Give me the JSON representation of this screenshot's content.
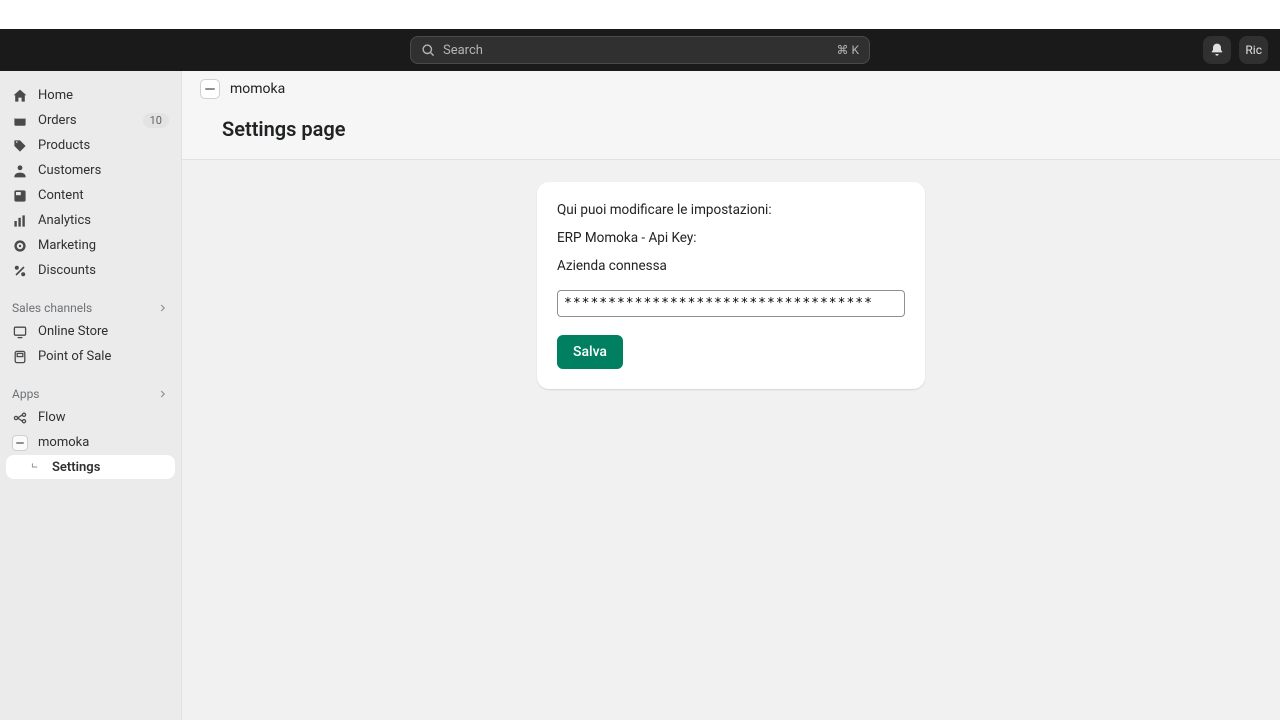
{
  "topbar": {
    "search_placeholder": "Search",
    "search_shortcut": "⌘ K",
    "user_short": "Ric"
  },
  "sidebar": {
    "items": [
      {
        "label": "Home"
      },
      {
        "label": "Orders",
        "badge": "10"
      },
      {
        "label": "Products"
      },
      {
        "label": "Customers"
      },
      {
        "label": "Content"
      },
      {
        "label": "Analytics"
      },
      {
        "label": "Marketing"
      },
      {
        "label": "Discounts"
      }
    ],
    "sales_channels_header": "Sales channels",
    "sales_channels": [
      {
        "label": "Online Store"
      },
      {
        "label": "Point of Sale"
      }
    ],
    "apps_header": "Apps",
    "apps": [
      {
        "label": "Flow"
      },
      {
        "label": "momoka"
      }
    ],
    "app_sub": {
      "label": "Settings"
    }
  },
  "breadcrumb": {
    "app": "momoka"
  },
  "page": {
    "title": "Settings page"
  },
  "card": {
    "intro": "Qui puoi modificare le impostazioni:",
    "api_key_label": "ERP Momoka - Api Key:",
    "connected_label": "Azienda connessa",
    "api_value_masked": "***********************************",
    "save_label": "Salva"
  }
}
